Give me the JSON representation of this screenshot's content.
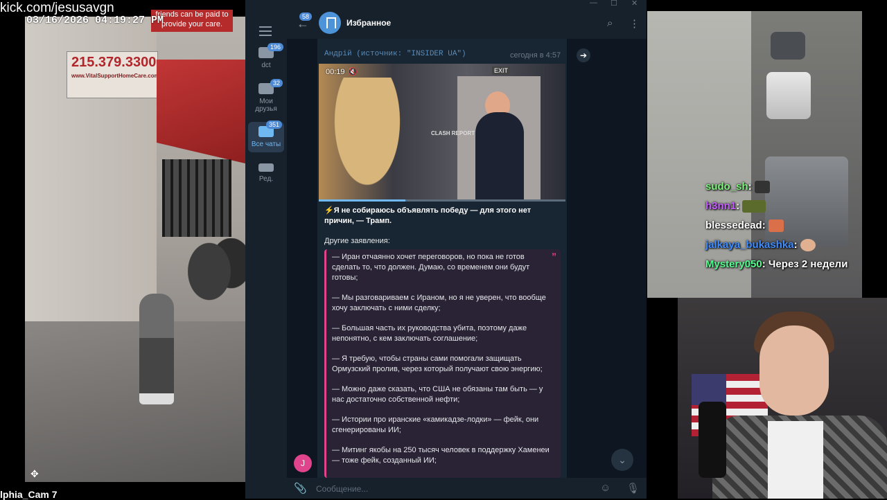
{
  "stream": {
    "url": "kick.com/jesusavgn",
    "timestamp": "03/16/2026 04:19:27 PM",
    "camera_caption": "lphia_Cam 7",
    "promo": "friends can be paid to provide your care.",
    "sign_phone": "215.379.3300",
    "sign_site": "www.VitalSupportHomeCare.com"
  },
  "chat": [
    {
      "user": "sudo_sh",
      "text": ":",
      "color": "#7cf27c"
    },
    {
      "user": "h3nn1",
      "text": ":",
      "color": "#c45cff"
    },
    {
      "user": "blessedead",
      "text": ":",
      "color": "#ffffff"
    },
    {
      "user": "jalkaya_bukashka",
      "text": ":",
      "color": "#3f8cff"
    },
    {
      "user": "Mystery050",
      "text": ": Через 2 недели",
      "color": "#53fc8e"
    }
  ],
  "telegram": {
    "rail": {
      "items": [
        {
          "label": "dct",
          "badge": "196"
        },
        {
          "label": "Мои друзья",
          "badge": "32"
        },
        {
          "label": "Все чаты",
          "badge": "351"
        },
        {
          "label": "Ред.",
          "badge": ""
        }
      ]
    },
    "header": {
      "back_badge": "58",
      "title": "Избранное"
    },
    "message": {
      "forwarded_from": "Андрій (источник: \"INSIDER UA\")",
      "time": "сегодня в 4:57",
      "video_time": "00:19",
      "video_exit": "EXIT",
      "video_watermark": "CLASH REPORT",
      "caption": "⚡Я не собираюсь объявлять победу — для этого нет причин, — Трамп.",
      "subheading": "Другие заявления:",
      "quote_lines": [
        "— Иран отчаянно хочет переговоров, но пока не готов сделать то, что должен. Думаю, со временем они будут готовы;",
        "— Мы разговариваем с Ираном, но я не уверен, что вообще хочу заключать с ними сделку;",
        "— Большая часть их руководства убита, поэтому даже непонятно, с кем заключать соглашение;",
        "— Я требую, чтобы страны сами помогали защищать Ормузский пролив, через который получают свою энергию;",
        "— Можно даже сказать, что США не обязаны там быть — у нас достаточно собственной нефти;",
        "— Истории про иранские «камикадзе-лодки» — фейк, они сгенерированы ИИ;",
        "— Митинг якобы на 250 тысяч человек в поддержку Хаменеи — тоже фейк, созданный ИИ;"
      ],
      "video_progress": 0.35
    },
    "user_avatar_letter": "J",
    "composer_placeholder": "Сообщение..."
  },
  "colors": {
    "accent": "#4d8ad6",
    "quote_border": "#e0448c",
    "bg": "#0e1621"
  }
}
